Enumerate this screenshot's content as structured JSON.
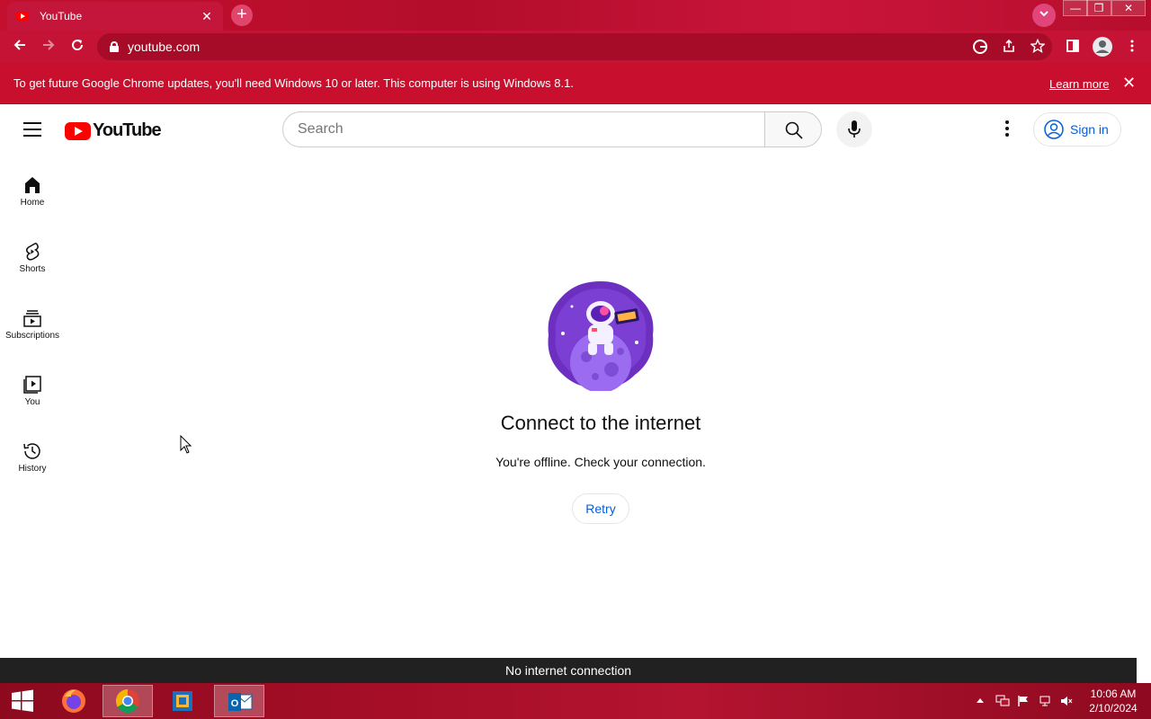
{
  "browser": {
    "tab_title": "YouTube",
    "tab_close": "✕",
    "new_tab": "+",
    "url": "youtube.com",
    "window_controls": [
      "—",
      "❐",
      "✕"
    ]
  },
  "infobar": {
    "message": "To get future Google Chrome updates, you'll need Windows 10 or later. This computer is using Windows 8.1.",
    "learn_more": "Learn more",
    "close": "✕"
  },
  "header": {
    "logo_text": "YouTube",
    "search_placeholder": "Search",
    "sign_in": "Sign in"
  },
  "sidebar": {
    "items": [
      {
        "label": "Home",
        "icon": "home-icon"
      },
      {
        "label": "Shorts",
        "icon": "shorts-icon"
      },
      {
        "label": "Subscriptions",
        "icon": "subscriptions-icon"
      },
      {
        "label": "You",
        "icon": "you-icon"
      },
      {
        "label": "History",
        "icon": "history-icon"
      }
    ]
  },
  "main": {
    "title": "Connect to the internet",
    "subtitle": "You're offline. Check your connection.",
    "retry": "Retry"
  },
  "snackbar": {
    "message": "No internet connection"
  },
  "taskbar": {
    "apps": [
      "start-icon",
      "firefox-icon",
      "chrome-icon",
      "virtualbox-icon",
      "outlook-icon"
    ],
    "time": "10:06 AM",
    "date": "2/10/2024"
  },
  "colors": {
    "chrome_frame": "#c51335",
    "yt_red": "#ff0000",
    "link_blue": "#065fd4",
    "snackbar_bg": "#212121"
  }
}
